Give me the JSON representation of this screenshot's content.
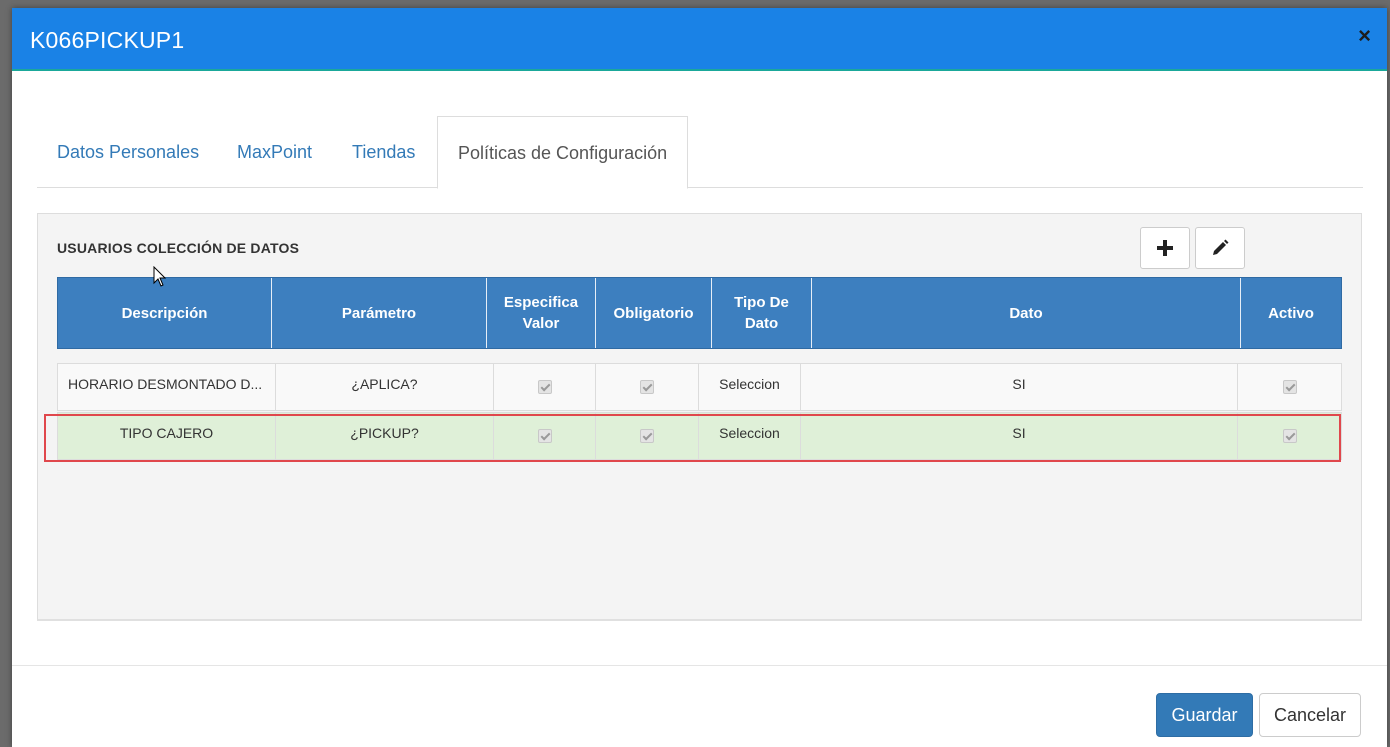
{
  "modal": {
    "title": "K066PICKUP1",
    "close_label": "×"
  },
  "tabs": [
    {
      "label": "Datos Personales",
      "active": false
    },
    {
      "label": "MaxPoint",
      "active": false
    },
    {
      "label": "Tiendas",
      "active": false
    },
    {
      "label": "Políticas de Configuración",
      "active": true
    }
  ],
  "panel": {
    "title": "USUARIOS COLECCIÓN DE DATOS",
    "add_icon": "plus-icon",
    "edit_icon": "pencil-icon"
  },
  "grid": {
    "columns": [
      {
        "label": "Descripción"
      },
      {
        "label": "Parámetro"
      },
      {
        "label": "Especifica Valor",
        "lines": [
          "Especifica",
          "Valor"
        ]
      },
      {
        "label": "Obligatorio"
      },
      {
        "label": "Tipo De Dato",
        "lines": [
          "Tipo De",
          "Dato"
        ]
      },
      {
        "label": "Dato"
      },
      {
        "label": "Activo"
      }
    ],
    "rows": [
      {
        "descripcion": "HORARIO DESMONTADO D...",
        "parametro": "¿APLICA?",
        "especifica_valor": true,
        "obligatorio": true,
        "tipo_dato": "Seleccion",
        "dato": "SI",
        "activo": true,
        "selected": false
      },
      {
        "descripcion": "TIPO CAJERO",
        "parametro": "¿PICKUP?",
        "especifica_valor": true,
        "obligatorio": true,
        "tipo_dato": "Seleccion",
        "dato": "SI",
        "activo": true,
        "selected": true
      }
    ]
  },
  "footer": {
    "save_label": "Guardar",
    "cancel_label": "Cancelar"
  },
  "colors": {
    "header_bg": "#1a82e6",
    "grid_header_bg": "#3d7fbf",
    "selected_row_bg": "#dff0d8",
    "highlight_border": "#e0474c",
    "primary_button": "#337ab7"
  }
}
